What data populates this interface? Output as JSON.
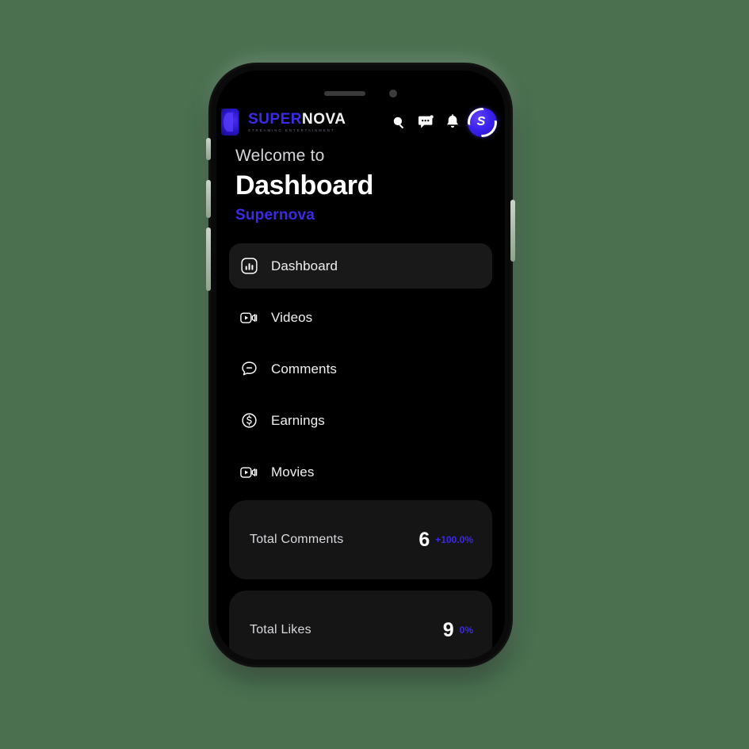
{
  "theme": {
    "page_background": "#4a7050",
    "screen_background": "#000000",
    "accent": "#3b2ae8",
    "card_background": "#151515",
    "active_nav_background": "#191919",
    "text_primary": "#ffffff",
    "text_secondary": "#d6d6da"
  },
  "phone": {
    "notch": {
      "speaker": "speaker-slot",
      "camera": "camera-dot"
    },
    "buttons": [
      "silent-switch",
      "volume-up",
      "volume-down",
      "power"
    ]
  },
  "header": {
    "logo_mark": "supernova-logo-mark",
    "logo_word_primary": "SUPER",
    "logo_word_secondary": "NOVA",
    "logo_tagline": "STREAMING ENTERTAINMENT",
    "icons": [
      {
        "name": "search-icon",
        "label": "Search"
      },
      {
        "name": "messages-icon",
        "label": "Messages"
      },
      {
        "name": "notifications-icon",
        "label": "Notifications"
      }
    ],
    "avatar": {
      "name": "user-avatar",
      "initial": "S"
    }
  },
  "welcome": {
    "greeting": "Welcome to",
    "title": "Dashboard",
    "brand": "Supernova"
  },
  "nav": {
    "items": [
      {
        "label": "Dashboard",
        "icon": "bar-chart-icon",
        "active": true
      },
      {
        "label": "Videos",
        "icon": "video-icon",
        "active": false
      },
      {
        "label": "Comments",
        "icon": "comment-icon",
        "active": false
      },
      {
        "label": "Earnings",
        "icon": "dollar-icon",
        "active": false
      },
      {
        "label": "Movies",
        "icon": "video-icon",
        "active": false
      }
    ]
  },
  "stats": {
    "cards": [
      {
        "label": "Total Comments",
        "value": "6",
        "delta": "+100.0%"
      },
      {
        "label": "Total Likes",
        "value": "9",
        "delta": "0%"
      }
    ]
  }
}
